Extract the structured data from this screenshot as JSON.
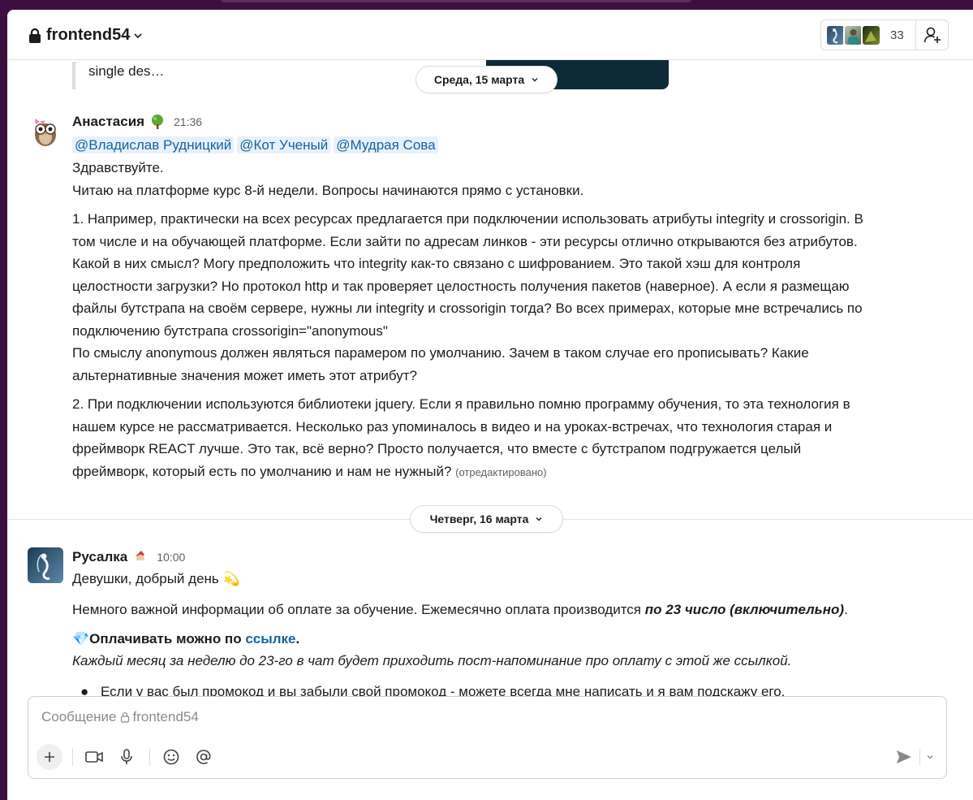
{
  "header": {
    "channel_name": "frontend54",
    "member_count": "33"
  },
  "top_snippet": "single des…",
  "dates": {
    "first": "Среда, 15 марта",
    "second": "Четверг, 16 марта"
  },
  "message1": {
    "author": "Анастасия",
    "status_icon": "tree-emoji",
    "time": "21:36",
    "mentions": [
      "@Владислав Рудницкий",
      "@Кот Ученый",
      "@Мудрая Сова"
    ],
    "greeting": "Здравствуйте.",
    "intro": "Читаю на платформе курс 8-й недели. Вопросы начинаются прямо с установки.",
    "p1_line1": "1. Например, практически на всех ресурсах предлагается при подключении использовать атрибуты integrity и crossorigin. В",
    "p1_line2": "том числе и на обучающей платформе. Если зайти по адресам линков - эти ресурсы отлично открываются без атрибутов.",
    "p1_line3": "Какой в них смысл? Могу предположить что integrity как-то связано с шифрованием. Это такой хэш для контроля",
    "p1_line4": "целостности загрузки? Но протокол http и так проверяет целостность получения пакетов (наверное). А если я размещаю",
    "p1_line5": "файлы бутстрапа на своём сервере, нужны ли integrity и crossorigin тогда? Во всех примерах, которые мне встречались по",
    "p1_line6": "подключению бутстрапа crossorigin=\"anonymous\"",
    "p1_line7": "По смыслу anonymous должен являться парамером по умолчанию. Зачем в таком случае его прописывать? Какие",
    "p1_line8": "альтернативные значения может иметь этот атрибут?",
    "p2_line1": "2. При подключении используются библиотеки jquery. Если я правильно помню программу обучения, то эта технология в",
    "p2_line2": "нашем курсе не рассматривается.  Несколько раз упоминалось в видео и на уроках-встречах, что технология старая и",
    "p2_line3": "фреймворк REACT лучше. Это так, всё верно? Просто получается, что вместе с бутстрапом подгружается целый",
    "p2_line4": "фреймворк, который есть по умолчанию и нам не нужный?",
    "edited": "(отредактировано)"
  },
  "message2": {
    "author": "Русалка",
    "status_icon": "santa-emoji",
    "time": "10:00",
    "greeting": "Девушки, добрый день",
    "greeting_emoji": "💫",
    "info_prefix": "Немного важной информации об оплате за обучение. Ежемесячно оплата производится ",
    "info_bold": "по 23 число (включительно)",
    "info_suffix": ".",
    "pay_emoji": "💎",
    "pay_prefix": "Оплачивать можно по ",
    "pay_link": "ссылке",
    "pay_suffix": ".",
    "reminder": "Каждый месяц за неделю до 23-го в чат будет приходить пост-напоминание про оплату с этой же ссылкой.",
    "bullet1": "Если у вас был промокод  и вы забыли свой промокод - можете всегда мне написать и я вам подскажу его."
  },
  "composer": {
    "placeholder_prefix": "Сообщение",
    "placeholder_channel": "frontend54"
  },
  "colors": {
    "sidebar": "#3f0e40",
    "link": "#1264a3",
    "mention_bg": "#e8f1fa"
  }
}
